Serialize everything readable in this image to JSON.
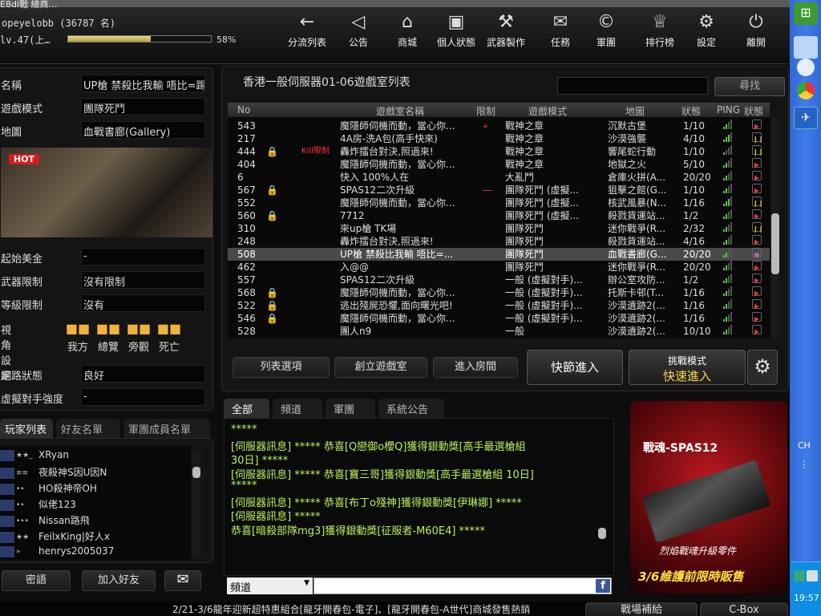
{
  "window_strip_text": "E8dl戰 總商…",
  "user": {
    "name": "opeyelobb (36787 名)",
    "level": "lv.47(上…",
    "exp_percent": "58%",
    "exp_fraction": 0.58
  },
  "nav": [
    {
      "label": "分流列表",
      "icon": "back-arrow-icon",
      "glyph": "←"
    },
    {
      "label": "公告",
      "icon": "speaker-icon",
      "glyph": "◁"
    },
    {
      "label": "商城",
      "icon": "shop-icon",
      "glyph": "⌂"
    },
    {
      "label": "個人狀態",
      "icon": "profile-card-icon",
      "glyph": "▣"
    },
    {
      "label": "武器製作",
      "icon": "gun-icon",
      "glyph": "⚒"
    },
    {
      "label": "任務",
      "icon": "mission-icon",
      "glyph": "✉"
    },
    {
      "label": "軍團",
      "icon": "clan-icon",
      "glyph": "©"
    },
    {
      "label": "排行榜",
      "icon": "trophy-icon",
      "glyph": "♕"
    },
    {
      "label": "設定",
      "icon": "gear-icon",
      "glyph": "⚙"
    },
    {
      "label": "離開",
      "icon": "power-icon",
      "glyph": "⏻"
    }
  ],
  "room_info": {
    "fields": [
      {
        "k": "名稱",
        "v": "UP槍 禁殺比我輸 唔比=踢 唔該"
      },
      {
        "k": "遊戲模式",
        "v": "團隊死鬥"
      },
      {
        "k": "地圖",
        "v": "血戰書廊(Gallery)"
      }
    ],
    "hot": "HOT",
    "fields2": [
      {
        "k": "起始美金",
        "v": "-"
      },
      {
        "k": "武器限制",
        "v": "沒有限制"
      },
      {
        "k": "等級限制",
        "v": "沒有"
      }
    ],
    "view_label": "視角設定",
    "cams": [
      "我方",
      "總覽",
      "旁觀",
      "死亡"
    ],
    "fields3": [
      {
        "k": "網路狀態",
        "v": "良好"
      },
      {
        "k": "虛擬對手強度",
        "v": "-"
      }
    ]
  },
  "friend_tabs": [
    "玩家列表",
    "好友名單",
    "軍團成員名單"
  ],
  "players": [
    {
      "rank": "★★_",
      "name": "XRyan"
    },
    {
      "rank": "≡≡",
      "name": "夜殺神S因U因N"
    },
    {
      "rank": "••",
      "name": "HO殺神帝OH"
    },
    {
      "rank": "••",
      "name": "似佬123"
    },
    {
      "rank": "•••",
      "name": "Nissan路飛"
    },
    {
      "rank": "★★",
      "name": "FeilxKing|好人x"
    },
    {
      "rank": "»",
      "name": "henrys2005037"
    }
  ],
  "left_buttons": {
    "secret": "密語",
    "add_friend": "加入好友"
  },
  "roomlist": {
    "title": "香港一般伺服器01-06遊戲室列表",
    "search_btn": "尋找",
    "headers": {
      "no": "No",
      "name": "遊戲室名稱",
      "limit": "限制",
      "mode": "遊戲模式",
      "map": "地圖",
      "status": "狀態",
      "ping": "PING",
      "state": "狀態"
    },
    "rows": [
      {
        "no": "543",
        "name": "魔隱師伺機而動，當心你...",
        "limit": "⌖",
        "mode": "戰神之章",
        "map": "沉默古堡",
        "status": "1/10",
        "ping": 2,
        "st": "▶",
        "lock": ""
      },
      {
        "no": "217",
        "name": "4A房-洗A包(高手快來)",
        "limit": "",
        "mode": "戰神之章",
        "map": "沙漠強襲",
        "status": "4/10",
        "ping": 3,
        "st": "❙❙",
        "lock": ""
      },
      {
        "no": "444",
        "name": "轟炸擂台對決,照過來!",
        "limit": "",
        "mode": "戰神之章",
        "map": "響尾蛇行動",
        "status": "1/10",
        "ping": 1,
        "st": "❙❙",
        "lock": "封",
        "kill": "Kill限制"
      },
      {
        "no": "404",
        "name": "魔隱師伺機而動，當心你...",
        "limit": "",
        "mode": "戰神之章",
        "map": "地獄之火",
        "status": "5/10",
        "ping": 2,
        "st": "▶",
        "lock": ""
      },
      {
        "no": "6",
        "name": "快入 100%人在",
        "limit": "",
        "mode": "大亂鬥",
        "map": "倉庫火拼(A...",
        "status": "20/20",
        "ping": 2,
        "st": "▶",
        "lock": ""
      },
      {
        "no": "567",
        "name": "SPAS12二次升級",
        "limit": "―",
        "mode": "團隊死鬥 (虛擬...",
        "map": "狙擊之館(G...",
        "status": "1/10",
        "ping": 2,
        "st": "▶",
        "lock": "封"
      },
      {
        "no": "552",
        "name": "魔隱師伺機而動，當心你...",
        "limit": "",
        "mode": "團隊死鬥 (虛擬...",
        "map": "核武風暴(N...",
        "status": "1/16",
        "ping": 3,
        "st": "❙❙",
        "lock": ""
      },
      {
        "no": "560",
        "name": "7712",
        "limit": "",
        "mode": "團隊死鬥 (虛擬...",
        "map": "殺戮貨運站...",
        "status": "1/2",
        "ping": 2,
        "st": "▶",
        "lock": "封"
      },
      {
        "no": "310",
        "name": "來up槍    TK場",
        "limit": "",
        "mode": "團隊死鬥",
        "map": "迷你戰爭(R...",
        "status": "2/32",
        "ping": 2,
        "st": "❙❙",
        "lock": ""
      },
      {
        "no": "248",
        "name": "轟炸擂台對決,照過來!",
        "limit": "",
        "mode": "團隊死鬥",
        "map": "殺戮貨運站...",
        "status": "4/16",
        "ping": 2,
        "st": "▶",
        "lock": ""
      },
      {
        "no": "508",
        "name": "UP槍 禁殺比我輸 唔比=...",
        "limit": "",
        "mode": "團隊死鬥",
        "map": "血戰書廊(G...",
        "status": "20/20",
        "ping": 2,
        "st": "●",
        "lock": "",
        "sel": true
      },
      {
        "no": "462",
        "name": "入@@",
        "limit": "",
        "mode": "團隊死鬥",
        "map": "迷你戰爭(R...",
        "status": "20/20",
        "ping": 2,
        "st": "▶",
        "lock": ""
      },
      {
        "no": "557",
        "name": "SPAS12二次升級",
        "limit": "",
        "mode": "一般 (虛擬對手)...",
        "map": "辦公室攻防...",
        "status": "1/2",
        "ping": 2,
        "st": "▶",
        "lock": ""
      },
      {
        "no": "568",
        "name": "魔隱師伺機而動，當心你...",
        "limit": "",
        "mode": "一般 (虛擬對手)...",
        "map": "托斯卡邨(T...",
        "status": "1/16",
        "ping": 2,
        "st": "▶",
        "lock": "封"
      },
      {
        "no": "522",
        "name": "逃出殘屍恐懼,面向曙光吧!",
        "limit": "",
        "mode": "一般 (虛擬對手)...",
        "map": "沙漠遺跡2(...",
        "status": "1/16",
        "ping": 2,
        "st": "▶",
        "lock": "封"
      },
      {
        "no": "546",
        "name": "魔隱師伺機而動，當心你...",
        "limit": "",
        "mode": "一般 (虛擬對手)...",
        "map": "沙漠遺跡2(...",
        "status": "1/16",
        "ping": 2,
        "st": "▶",
        "lock": "封"
      },
      {
        "no": "528",
        "name": "團人n9",
        "limit": "",
        "mode": "一般",
        "map": "沙漠遺跡2(...",
        "status": "10/10",
        "ping": 2,
        "st": "▶",
        "lock": ""
      }
    ],
    "buttons": {
      "options": "列表選項",
      "create": "創立遊戲室",
      "enter": "進入房間",
      "quick": "快節進入",
      "challenge_top": "挑戰模式",
      "challenge_bottom": "快速進入"
    }
  },
  "chat": {
    "tabs": [
      "全部",
      "頻道",
      "軍團",
      "系統公告"
    ],
    "lines": [
      "*****",
      "[伺服器訊息] ***** 恭喜[Q戀御o櫻Q]獲得銀動獎[高手最選槍組",
      "30日] *****",
      "[伺服器訊息] ***** 恭喜[寶三哥]獲得銀動獎[高手最選槍組 10日]",
      "*****",
      "[伺服器訊息] ***** 恭喜[布丁o殘神]獲得銀動獎[伊琳娜] *****",
      "[伺服器訊息] *****",
      "恭喜[暗殺部隊mg3]獲得銀動獎[征服者-M60E4] *****"
    ],
    "channel": "頻道"
  },
  "ad": {
    "title": "戰魂-SPAS12",
    "sub": "烈焰戰魂升級零件",
    "date": "3/6維護前限時販售"
  },
  "marquee": "2/21-3/6龍年迎新超特惠組合[龍牙開春包-電子]、[龍牙開春包-A世代]商城發售熱銷",
  "bottom_buttons": {
    "supply": "戰場補給",
    "cbox": "C-Box"
  },
  "taskbar": {
    "lang": "CH",
    "time": "19:57"
  }
}
